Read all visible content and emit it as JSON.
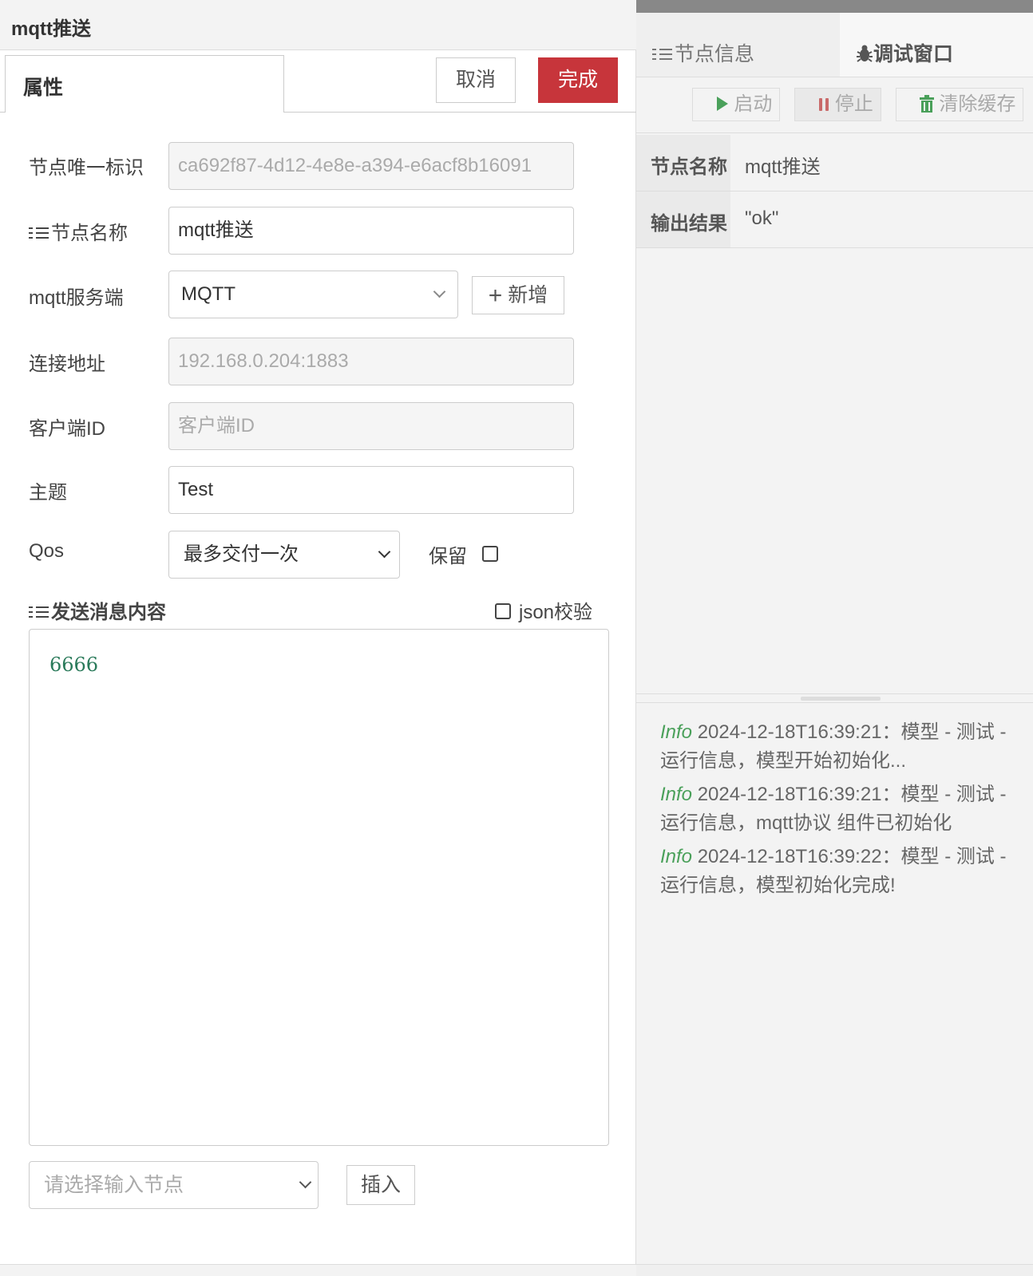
{
  "left": {
    "title": "mqtt推送",
    "tab_label": "属性",
    "cancel_label": "取消",
    "done_label": "完成",
    "fields": {
      "node_id": {
        "label": "节点唯一标识",
        "value": "ca692f87-4d12-4e8e-a394-e6acf8b16091"
      },
      "node_name": {
        "label": "节点名称",
        "value": "mqtt推送"
      },
      "mqtt_server": {
        "label": "mqtt服务端",
        "value": "MQTT",
        "add_label": "新增"
      },
      "address": {
        "label": "连接地址",
        "value": "192.168.0.204:1883"
      },
      "client_id": {
        "label": "客户端ID",
        "placeholder": "客户端ID"
      },
      "topic": {
        "label": "主题",
        "value": "Test"
      },
      "qos": {
        "label": "Qos",
        "value": "最多交付一次",
        "retain_label": "保留"
      }
    },
    "message": {
      "label": "发送消息内容",
      "json_check_label": "json校验",
      "content": "6666"
    },
    "input_select_placeholder": "请选择输入节点",
    "insert_label": "插入"
  },
  "right": {
    "tabs": {
      "info": "节点信息",
      "debug": "调试窗口"
    },
    "toolbar": {
      "start": "启动",
      "stop": "停止",
      "clear": "清除缓存"
    },
    "kv": [
      {
        "key": "节点名称",
        "value": "mqtt推送"
      },
      {
        "key": "输出结果",
        "value": "\"ok\""
      }
    ],
    "logs": [
      {
        "level": "Info",
        "text": " 2024-12-18T16:39:21：模型 - 测试 - 运行信息，模型开始初始化..."
      },
      {
        "level": "Info",
        "text": " 2024-12-18T16:39:21：模型 - 测试 - 运行信息，mqtt协议 组件已初始化"
      },
      {
        "level": "Info",
        "text": " 2024-12-18T16:39:22：模型 - 测试 - 运行信息，模型初始化完成!"
      }
    ],
    "colors": {
      "start_icon": "#4aa05a",
      "stop_icon": "#c96a6a",
      "clear_icon": "#4aa05a"
    }
  }
}
